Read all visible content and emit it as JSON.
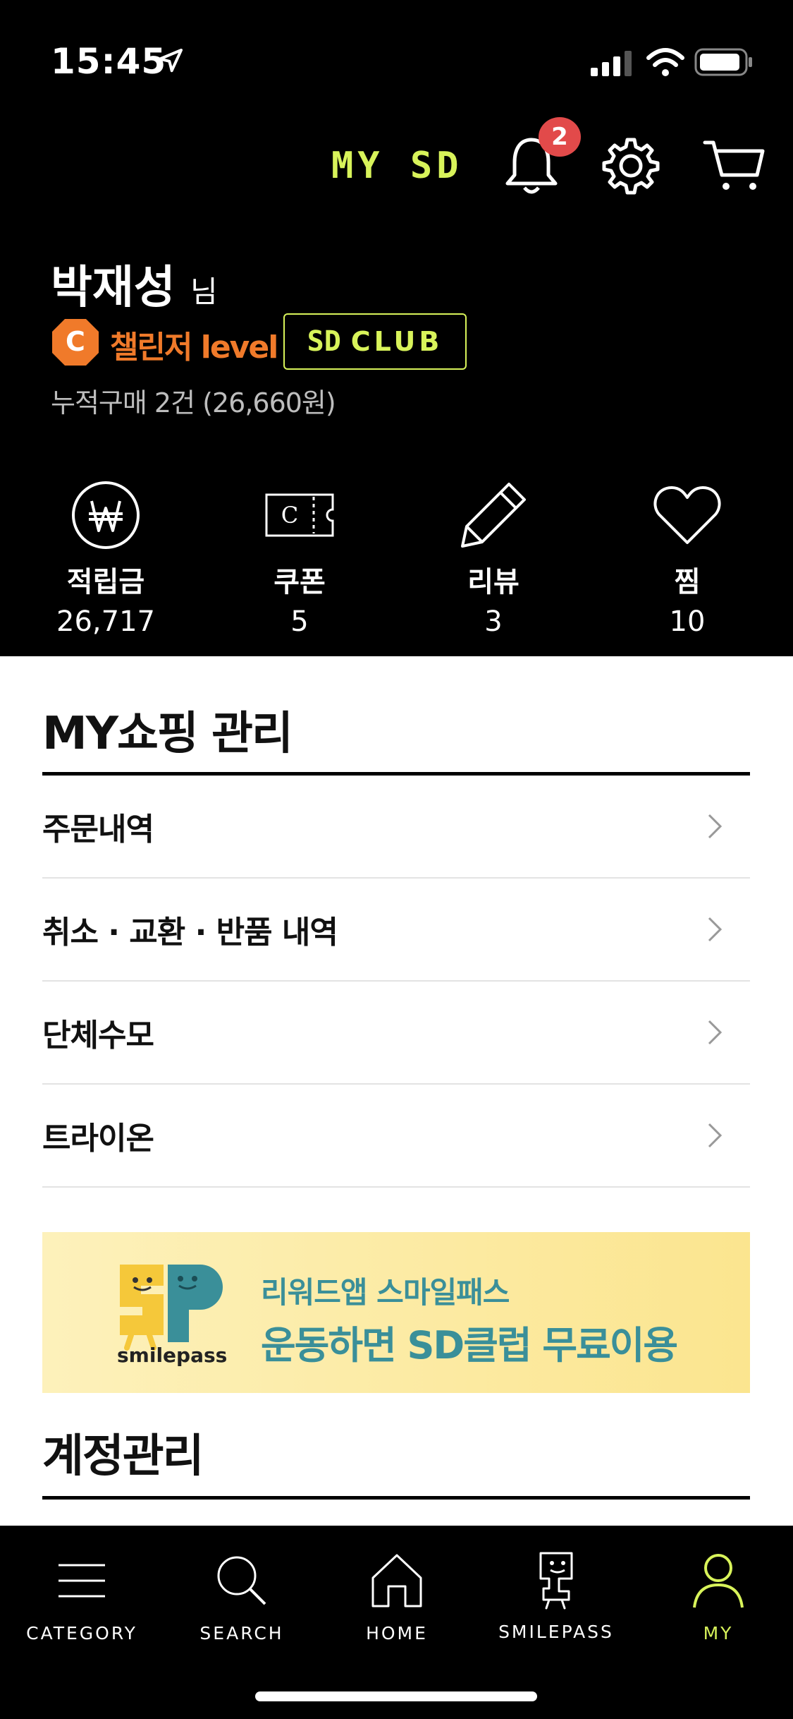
{
  "status_bar": {
    "time": "15:45"
  },
  "header": {
    "title": "MY SD",
    "notification_count": "2"
  },
  "user": {
    "name": "박재성",
    "suffix": "님",
    "level_letter": "C",
    "level_text": "챌린저 level",
    "club_logo": "SD",
    "club_label": "CLUB",
    "accumulated": "누적구매 2건 (26,660원)"
  },
  "stats": [
    {
      "label": "적립금",
      "value": "26,717",
      "icon": "won-icon"
    },
    {
      "label": "쿠폰",
      "value": "5",
      "icon": "coupon-icon"
    },
    {
      "label": "리뷰",
      "value": "3",
      "icon": "pencil-icon"
    },
    {
      "label": "찜",
      "value": "10",
      "icon": "heart-icon"
    }
  ],
  "shopping": {
    "title": "MY쇼핑 관리",
    "items": [
      {
        "label": "주문내역"
      },
      {
        "label": "취소 · 교환 · 반품 내역"
      },
      {
        "label": "단체수모"
      },
      {
        "label": "트라이온"
      }
    ]
  },
  "banner": {
    "logo_text": "smilepass",
    "line1": "리워드앱 스마일패스",
    "line2": "운동하면 SD클럽 무료이용"
  },
  "account": {
    "title": "계정관리"
  },
  "nav": [
    {
      "label": "CATEGORY",
      "icon": "menu-icon"
    },
    {
      "label": "SEARCH",
      "icon": "search-icon"
    },
    {
      "label": "HOME",
      "icon": "home-icon"
    },
    {
      "label": "SMILEPASS",
      "icon": "smilepass-icon"
    },
    {
      "label": "MY",
      "icon": "person-icon",
      "active": true
    }
  ],
  "colors": {
    "accent": "#d8f35a",
    "level": "#f07a2a",
    "badge": "#e24a4a",
    "banner_text": "#3a8f99"
  }
}
